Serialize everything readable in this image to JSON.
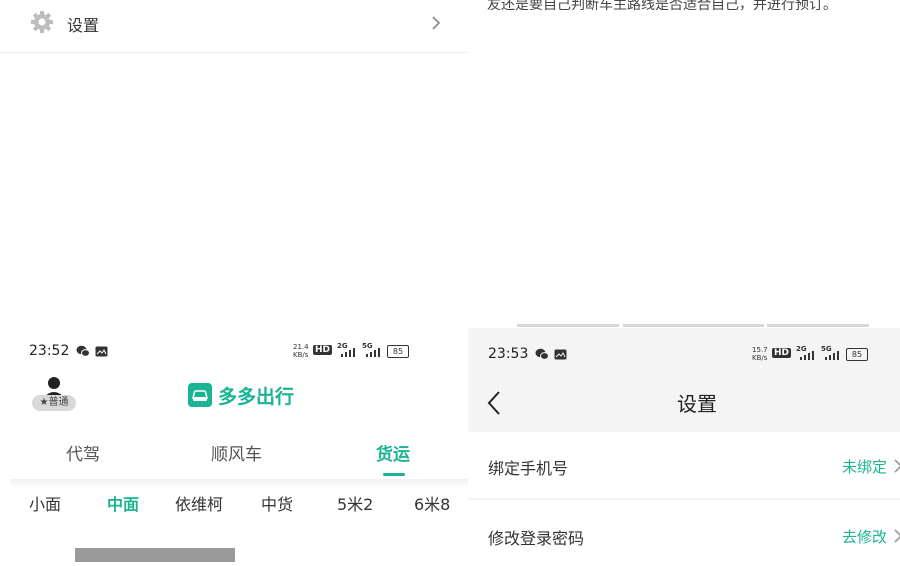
{
  "left_top": {
    "settings_label": "设置",
    "icons": {
      "settings": "gear-icon",
      "chevron": "chevron-right-icon"
    }
  },
  "right_top": {
    "note": "友还是要自己判断车主路线是否适合自己，并进行预订。"
  },
  "left_phone": {
    "status": {
      "time": "23:52",
      "speed": "21.4",
      "speed_unit": "KB/s",
      "hd": "HD",
      "g1": "2G",
      "g2": "5G",
      "battery": "85"
    },
    "badge": "★普通",
    "brand": "多多出行",
    "tabs": [
      {
        "label": "代驾",
        "active": false
      },
      {
        "label": "顺风车",
        "active": false
      },
      {
        "label": "货运",
        "active": true
      }
    ],
    "categories": [
      {
        "label": "小面",
        "active": false
      },
      {
        "label": "中面",
        "active": true
      },
      {
        "label": "依维柯",
        "active": false
      },
      {
        "label": "中货",
        "active": false
      },
      {
        "label": "5米2",
        "active": false
      },
      {
        "label": "6米8",
        "active": false
      }
    ]
  },
  "right_phone": {
    "status": {
      "time": "23:53",
      "speed": "15.7",
      "speed_unit": "KB/s",
      "hd": "HD",
      "g1": "2G",
      "g2": "5G",
      "battery": "85"
    },
    "title": "设置",
    "rows": [
      {
        "label": "绑定手机号",
        "value": "未绑定"
      },
      {
        "label": "修改登录密码",
        "value": "去修改"
      }
    ]
  },
  "colors": {
    "accent": "#1ab394"
  }
}
